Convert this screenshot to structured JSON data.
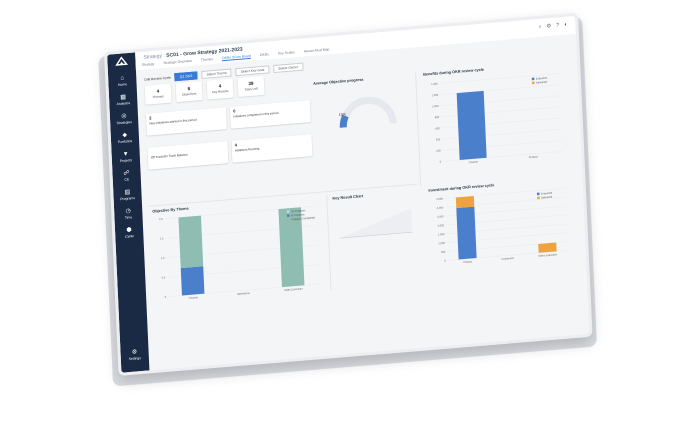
{
  "app": {
    "breadcrumb_prefix": "Strategy :",
    "breadcrumb_title": "SC01 - Grow Strategy 2021-2023",
    "top_icons": "⌕ ⚙ ? ◐"
  },
  "sidebar": {
    "items": [
      {
        "icon": "home-icon",
        "label": "Home"
      },
      {
        "icon": "analytics-icon",
        "label": "Analytics"
      },
      {
        "icon": "strategies-icon",
        "label": "Strategies"
      },
      {
        "icon": "portfolios-icon",
        "label": "Portfolios"
      },
      {
        "icon": "projects-icon",
        "label": "Projects"
      },
      {
        "icon": "ce-icon",
        "label": "CE"
      },
      {
        "icon": "programs-icon",
        "label": "Programs"
      },
      {
        "icon": "time-icon",
        "label": "Time"
      },
      {
        "icon": "cube-icon",
        "label": "CWM"
      }
    ],
    "settings_label": "Settings"
  },
  "tabs": [
    {
      "label": "Strategy",
      "active": false
    },
    {
      "label": "Strategic Overview",
      "active": false
    },
    {
      "label": "Themes",
      "active": false
    },
    {
      "label": "OKRs Score Board",
      "active": true
    },
    {
      "label": "OKRs",
      "active": false
    },
    {
      "label": "Key Scales",
      "active": false
    },
    {
      "label": "Hierarchical Map",
      "active": false
    }
  ],
  "filters": {
    "label": "Drill Review Cycle",
    "cycle_value": "Q1 2021",
    "theme_placeholder": "Select Theme",
    "key_goal_placeholder": "Select Key Goal",
    "owner_placeholder": "Select Owner"
  },
  "kpis": [
    {
      "value": "4",
      "label": "Themes"
    },
    {
      "value": "6",
      "label": "Objectives"
    },
    {
      "value": "4",
      "label": "Key Results"
    },
    {
      "value": "39",
      "label": "Days Left"
    }
  ],
  "initiatives": [
    {
      "count": "2",
      "text": "New Initiatives started in this period"
    },
    {
      "count": "0",
      "text": "Initiatives completed in this period"
    },
    {
      "count": "",
      "text": "Off Track/On Track Balance"
    },
    {
      "count": "4",
      "text": "Initiatives Running"
    }
  ],
  "avg_progress": {
    "title": "Average Objective progress",
    "value": "15%",
    "fraction": 0.15
  },
  "benefits": {
    "title": "Benefits during OKR review cycle",
    "legend": [
      "Executive",
      "Delivered"
    ]
  },
  "investment": {
    "title": "Investment during OKR review cycle",
    "legend": [
      "Executive",
      "Delivered"
    ]
  },
  "objective_by_theme": {
    "title": "Objective By Theme",
    "legend": [
      "On Progress",
      "At Progress",
      "Progress Completed"
    ]
  },
  "key_result_chart": {
    "title": "Key Result Chart"
  },
  "colors": {
    "sidebar": "#1a2a45",
    "blue": "#4a7fcc",
    "teal": "#8fbdb2",
    "orange": "#eea33f",
    "accent": "#3a7bd5"
  },
  "chart_data": [
    {
      "type": "bar",
      "title": "Benefits during OKR review cycle",
      "categories": [
        "Finance",
        "Product"
      ],
      "series": [
        {
          "name": "Executive",
          "values": [
            1200,
            0
          ]
        },
        {
          "name": "Delivered",
          "values": [
            0,
            0
          ]
        }
      ],
      "ylim": [
        0,
        1400
      ],
      "yticks": [
        "1,400",
        "1,200",
        "1,000",
        "800",
        "600",
        "400",
        "200",
        "0"
      ]
    },
    {
      "type": "bar",
      "title": "Investment during OKR review cycle",
      "categories": [
        "Product",
        "Customers",
        "Sales Execution"
      ],
      "series": [
        {
          "name": "Executive",
          "values": [
            2900,
            0,
            0
          ]
        },
        {
          "name": "Delivered",
          "values": [
            600,
            0,
            500
          ]
        }
      ],
      "ylim": [
        0,
        3500
      ],
      "yticks": [
        "3,500",
        "3,000",
        "2,500",
        "2,000",
        "1,500",
        "1,000",
        "500",
        "0"
      ]
    },
    {
      "type": "bar",
      "title": "Objective By Theme",
      "categories": [
        "Finance",
        "Operations",
        "Sales Execution"
      ],
      "series": [
        {
          "name": "On Progress",
          "values": [
            0,
            0,
            0
          ]
        },
        {
          "name": "At Progress",
          "values": [
            0.7,
            0,
            0
          ]
        },
        {
          "name": "Progress Completed",
          "values": [
            1.3,
            0,
            2
          ]
        }
      ],
      "ylim": [
        0,
        2
      ],
      "yticks": [
        "2.0",
        "1.5",
        "1.0",
        "0.5",
        "0"
      ]
    }
  ]
}
